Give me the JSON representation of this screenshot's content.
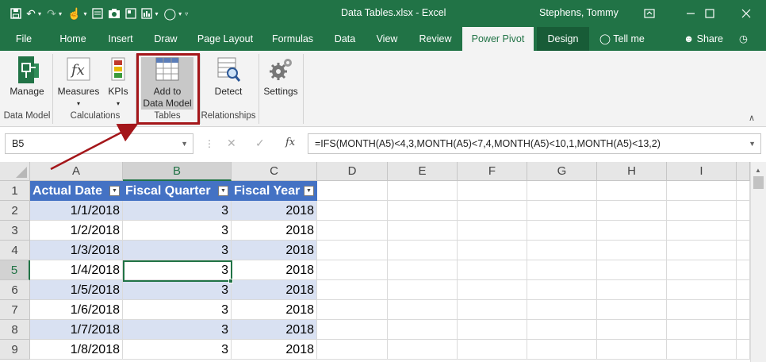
{
  "window": {
    "title": "Data Tables.xlsx  -  Excel",
    "user": "Stephens, Tommy"
  },
  "tabs": [
    {
      "label": "File"
    },
    {
      "label": "Home"
    },
    {
      "label": "Insert"
    },
    {
      "label": "Draw"
    },
    {
      "label": "Page Layout"
    },
    {
      "label": "Formulas"
    },
    {
      "label": "Data"
    },
    {
      "label": "View"
    },
    {
      "label": "Review"
    },
    {
      "label": "Power Pivot"
    },
    {
      "label": "Design"
    }
  ],
  "tell_me": "Tell me",
  "share": "Share",
  "ribbon": {
    "manage": "Manage",
    "measures": "Measures",
    "kpis": "KPIs",
    "add_to_data_model_line1": "Add to",
    "add_to_data_model_line2": "Data Model",
    "detect": "Detect",
    "settings": "Settings",
    "groups": {
      "data_model": "Data Model",
      "calculations": "Calculations",
      "tables": "Tables",
      "relationships": "Relationships"
    }
  },
  "formula_bar": {
    "name_box": "B5",
    "fx": "fx",
    "formula": "=IFS(MONTH(A5)<4,3,MONTH(A5)<7,4,MONTH(A5)<10,1,MONTH(A5)<13,2)"
  },
  "grid": {
    "columns": [
      "A",
      "B",
      "C",
      "D",
      "E",
      "F",
      "G",
      "H",
      "I"
    ],
    "row_numbers": [
      "1",
      "2",
      "3",
      "4",
      "5",
      "6",
      "7",
      "8",
      "9"
    ],
    "table_headers": [
      "Actual Date",
      "Fiscal Quarter",
      "Fiscal Year"
    ],
    "rows": [
      [
        "1/1/2018",
        "3",
        "2018"
      ],
      [
        "1/2/2018",
        "3",
        "2018"
      ],
      [
        "1/3/2018",
        "3",
        "2018"
      ],
      [
        "1/4/2018",
        "3",
        "2018"
      ],
      [
        "1/5/2018",
        "3",
        "2018"
      ],
      [
        "1/6/2018",
        "3",
        "2018"
      ],
      [
        "1/7/2018",
        "3",
        "2018"
      ],
      [
        "1/8/2018",
        "3",
        "2018"
      ]
    ],
    "active_cell": "B5"
  },
  "colors": {
    "excel_green": "#217346",
    "table_header": "#4472c4",
    "table_band": "#d9e1f2",
    "annotation": "#a4161a"
  }
}
